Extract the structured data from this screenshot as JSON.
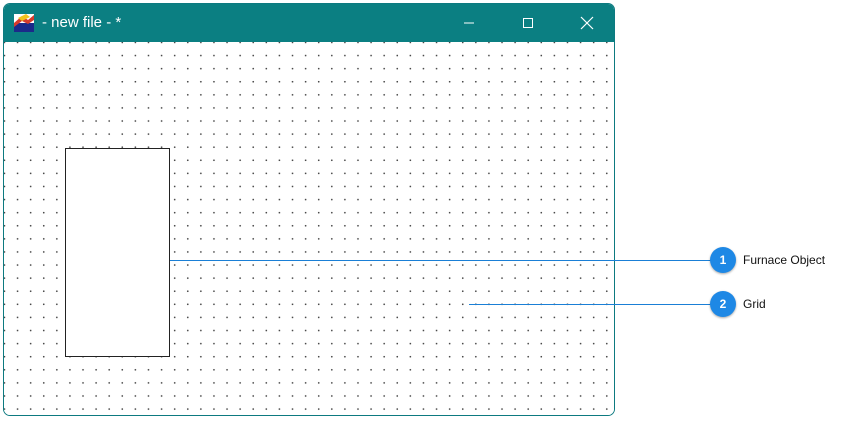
{
  "window": {
    "title": "- new file - *",
    "app_icon": "app-logo-icon"
  },
  "controls": {
    "minimize": "minimize-icon",
    "maximize": "maximize-icon",
    "close": "close-icon"
  },
  "callouts": [
    {
      "number": "1",
      "label": "Furnace Object"
    },
    {
      "number": "2",
      "label": "Grid"
    }
  ],
  "colors": {
    "titlebar": "#0b7f82",
    "callout_accent": "#1e88e5"
  }
}
